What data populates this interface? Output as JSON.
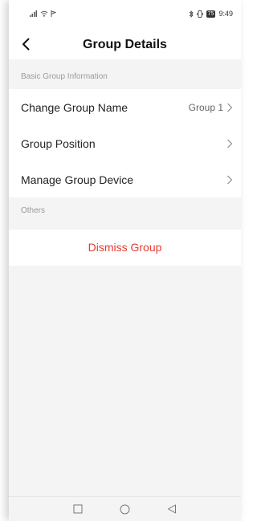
{
  "status_bar": {
    "signal_icon": "signal-icon",
    "wifi_icon": "wifi-icon",
    "bluetooth_icon": "bluetooth-icon",
    "battery": "75",
    "time": "9:49"
  },
  "header": {
    "title": "Group Details",
    "back_icon": "chevron-left-icon"
  },
  "sections": {
    "basic_title": "Basic Group Information",
    "others_title": "Others"
  },
  "items": [
    {
      "label": "Change Group Name",
      "value": "Group 1"
    },
    {
      "label": "Group Position",
      "value": ""
    },
    {
      "label": "Manage Group Device",
      "value": ""
    }
  ],
  "dismiss_label": "Dismiss Group",
  "colors": {
    "danger": "#e8392f",
    "background": "#f4f4f4"
  },
  "bottom_nav": [
    "square-icon",
    "circle-icon",
    "triangle-back-icon"
  ]
}
